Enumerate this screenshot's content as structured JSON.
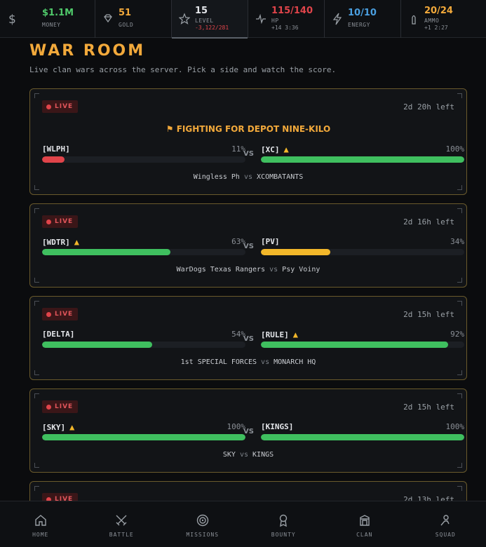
{
  "stats": [
    {
      "value": "$1.1M",
      "label": "MONEY",
      "sub": "",
      "color": "#4fc86a",
      "icon": "dollar-icon"
    },
    {
      "value": "51",
      "label": "GOLD",
      "sub": "",
      "color": "#f2a93b",
      "icon": "gem-icon"
    },
    {
      "value": "15",
      "label": "LEVEL",
      "sub": "-3,122/281",
      "color": "#e4e6ea",
      "sub_color": "#e0444a",
      "icon": "star-icon"
    },
    {
      "value": "115/140",
      "label": "HP",
      "sub": "+14 3:36",
      "color": "#e0444a",
      "icon": "heartbeat-icon"
    },
    {
      "value": "10/10",
      "label": "ENERGY",
      "sub": "",
      "color": "#4a9fe0",
      "icon": "lightning-icon"
    },
    {
      "value": "20/24",
      "label": "AMMO",
      "sub": "+1 2:27",
      "color": "#f2a93b",
      "icon": "bullet-icon"
    }
  ],
  "page": {
    "title": "WAR ROOM",
    "subtitle": "Live clan wars across the server. Pick a side and watch the score."
  },
  "live_label": "LIVE",
  "vs_label": "VS",
  "vs_small": "vs",
  "wars": [
    {
      "time_left": "2d 20h left",
      "objective": "⚑ FIGHTING FOR DEPOT NINE-KILO",
      "left": {
        "tag": "[WLPH]",
        "percent": "11%",
        "fill": 0.11,
        "color": "#e0444a",
        "warn": false,
        "name": "Wingless Ph"
      },
      "right": {
        "tag": "[XC]",
        "percent": "100%",
        "fill": 1.0,
        "color": "#3fbf5f",
        "warn": true,
        "name": "XCOMBATANTS"
      }
    },
    {
      "time_left": "2d 16h left",
      "objective": "",
      "left": {
        "tag": "[WDTR]",
        "percent": "63%",
        "fill": 0.63,
        "color": "#3fbf5f",
        "warn": true,
        "name": "WarDogs Texas Rangers"
      },
      "right": {
        "tag": "[PV]",
        "percent": "34%",
        "fill": 0.34,
        "color": "#f2b72a",
        "warn": false,
        "name": "Psy Voiny"
      }
    },
    {
      "time_left": "2d 15h left",
      "objective": "",
      "left": {
        "tag": "[DELTA]",
        "percent": "54%",
        "fill": 0.54,
        "color": "#3fbf5f",
        "warn": false,
        "name": "1st SPECIAL FORCES"
      },
      "right": {
        "tag": "[RULE]",
        "percent": "92%",
        "fill": 0.92,
        "color": "#3fbf5f",
        "warn": true,
        "name": "MONARCH HQ"
      }
    },
    {
      "time_left": "2d 15h left",
      "objective": "",
      "left": {
        "tag": "[SKY]",
        "percent": "100%",
        "fill": 1.0,
        "color": "#3fbf5f",
        "warn": true,
        "name": "SKY"
      },
      "right": {
        "tag": "[KINGS]",
        "percent": "100%",
        "fill": 1.0,
        "color": "#3fbf5f",
        "warn": false,
        "name": "KINGS"
      }
    },
    {
      "time_left": "2d 13h left",
      "objective": "",
      "left": {
        "tag": "",
        "percent": "",
        "fill": 0,
        "color": "#3fbf5f",
        "warn": false,
        "name": ""
      },
      "right": {
        "tag": "",
        "percent": "",
        "fill": 0,
        "color": "#3fbf5f",
        "warn": false,
        "name": ""
      }
    }
  ],
  "nav": [
    {
      "label": "HOME",
      "icon": "home-icon"
    },
    {
      "label": "BATTLE",
      "icon": "crossed-swords-icon"
    },
    {
      "label": "MISSIONS",
      "icon": "target-icon"
    },
    {
      "label": "BOUNTY",
      "icon": "medal-icon"
    },
    {
      "label": "CLAN",
      "icon": "castle-icon"
    },
    {
      "label": "SQUAD",
      "icon": "user-icon"
    }
  ]
}
